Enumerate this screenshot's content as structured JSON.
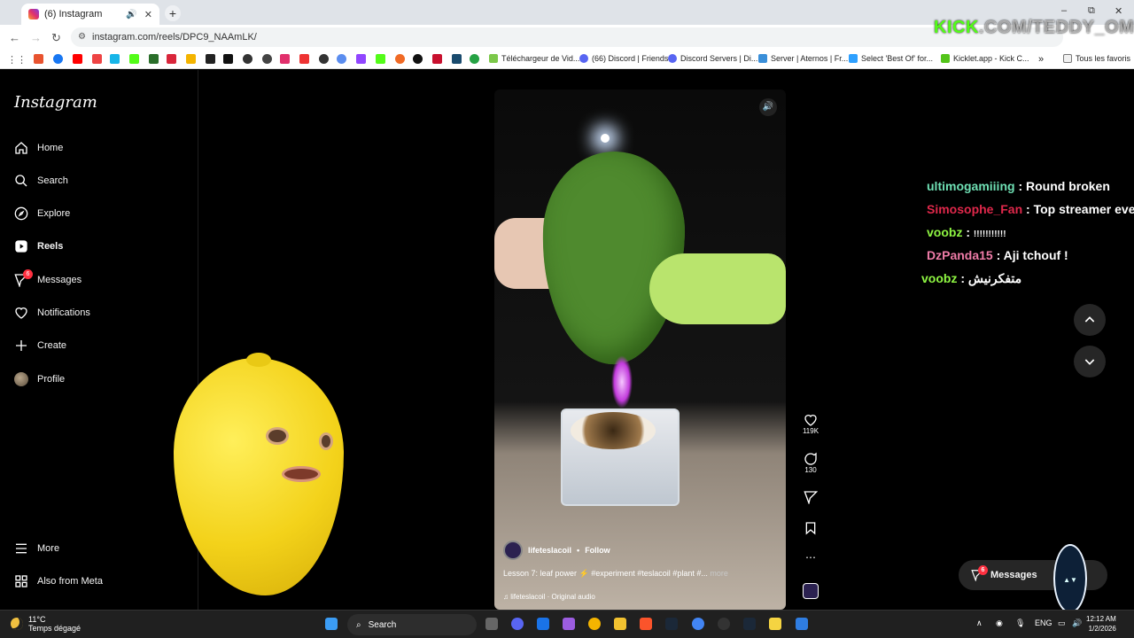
{
  "browser": {
    "tab_title": "(6) Instagram",
    "tab_sound_icon": "speaker-icon",
    "tab_close_icon": "close-icon",
    "new_tab": "+",
    "url": "instagram.com/reels/DPC9_NAAmLK/",
    "window_controls": [
      "–",
      "⧉",
      "✕"
    ],
    "bookmarks": [
      {
        "label": "Téléchargeur de Vid...",
        "color": "#7cc84a"
      },
      {
        "label": "(66) Discord | Friends",
        "color": "#5865f2"
      },
      {
        "label": "Discord Servers | Di...",
        "color": "#5865f2"
      },
      {
        "label": "Server | Aternos | Fr...",
        "color": "#3a8fd9"
      },
      {
        "label": "Select 'Best Of' for...",
        "color": "#2ea0ff"
      },
      {
        "label": "Kicklet.app - Kick C...",
        "color": "#53c41a"
      }
    ],
    "bookmarks_more": "»",
    "all_bookmarks": "Tous les favoris",
    "overlay_watermark_main": "KICK",
    "overlay_watermark_rest": ".COM/TEDDY_OMG"
  },
  "sidebar": {
    "logo": "Instagram",
    "items": [
      {
        "label": "Home",
        "icon": "home-icon"
      },
      {
        "label": "Search",
        "icon": "search-icon"
      },
      {
        "label": "Explore",
        "icon": "compass-icon"
      },
      {
        "label": "Reels",
        "icon": "reels-icon"
      },
      {
        "label": "Messages",
        "icon": "messages-icon",
        "badge": "6"
      },
      {
        "label": "Notifications",
        "icon": "heart-icon"
      },
      {
        "label": "Create",
        "icon": "plus-icon"
      },
      {
        "label": "Profile",
        "icon": "avatar-icon"
      }
    ],
    "bottom": [
      {
        "label": "More",
        "icon": "menu-icon"
      },
      {
        "label": "Also from Meta",
        "icon": "grid-icon"
      }
    ]
  },
  "reel": {
    "username": "lifeteslacoil",
    "separator": "•",
    "follow": "Follow",
    "caption": "Lesson 7: leaf power ⚡ #experiment #teslacoil #plant #...",
    "caption_more": "more",
    "audio": "lifeteslacoil · Original audio",
    "likes": "119K",
    "comments": "130"
  },
  "chat": [
    {
      "user": "ultimogamiiing",
      "message": "Round broken",
      "color": "#6fe0b4"
    },
    {
      "user": "Simosophe_Fan",
      "message": "Top streamer ever",
      "color": "#e0284b"
    },
    {
      "user": "voobz",
      "message": "!!!!!!!!!!!",
      "color": "#8ef542"
    },
    {
      "user": "DzPanda15",
      "message": "Aji tchouf !",
      "color": "#f07ca8"
    },
    {
      "user": "voobz",
      "message": "متفكرنيش",
      "color": "#8ef542"
    }
  ],
  "messages_pill": {
    "label": "Messages",
    "badge": "6"
  },
  "taskbar": {
    "temperature": "11°C",
    "weather_text": "Temps dégagé",
    "search": "Search",
    "language": "ENG",
    "time": "12:12 AM",
    "date": "1/2/2026"
  }
}
